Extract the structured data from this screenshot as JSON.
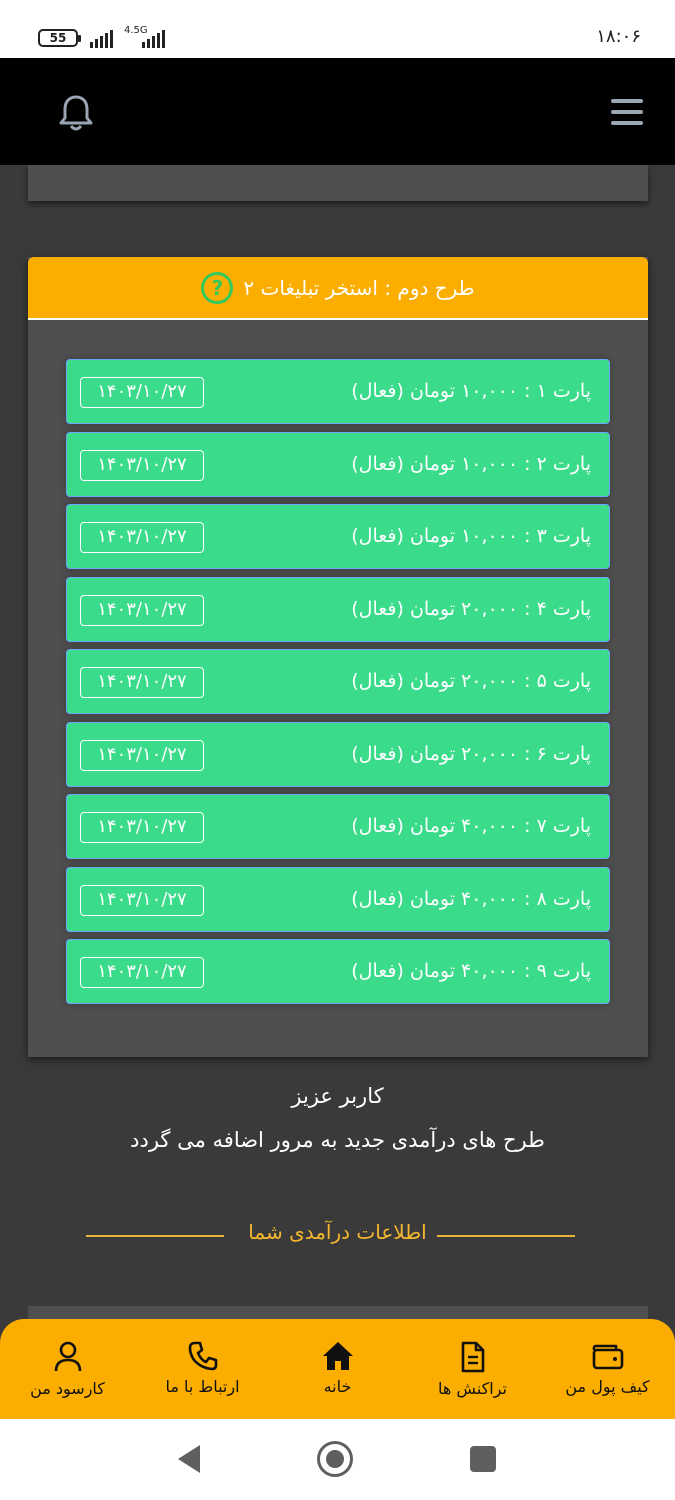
{
  "status_bar": {
    "battery": "55",
    "network": "4.5G",
    "clock": "۱۸:۰۶"
  },
  "plan": {
    "title": "طرح دوم : استخر تبلیغات ۲",
    "help_icon": "question-circle-icon",
    "parts": [
      {
        "label": "پارت ۱ : ۱۰,۰۰۰ تومان (فعال)",
        "date": "۱۴۰۳/۱۰/۲۷"
      },
      {
        "label": "پارت ۲ : ۱۰,۰۰۰ تومان (فعال)",
        "date": "۱۴۰۳/۱۰/۲۷"
      },
      {
        "label": "پارت ۳ : ۱۰,۰۰۰ تومان (فعال)",
        "date": "۱۴۰۳/۱۰/۲۷"
      },
      {
        "label": "پارت ۴ : ۲۰,۰۰۰ تومان (فعال)",
        "date": "۱۴۰۳/۱۰/۲۷"
      },
      {
        "label": "پارت ۵ : ۲۰,۰۰۰ تومان (فعال)",
        "date": "۱۴۰۳/۱۰/۲۷"
      },
      {
        "label": "پارت ۶ : ۲۰,۰۰۰ تومان (فعال)",
        "date": "۱۴۰۳/۱۰/۲۷"
      },
      {
        "label": "پارت ۷ : ۴۰,۰۰۰ تومان (فعال)",
        "date": "۱۴۰۳/۱۰/۲۷"
      },
      {
        "label": "پارت ۸ : ۴۰,۰۰۰ تومان (فعال)",
        "date": "۱۴۰۳/۱۰/۲۷"
      },
      {
        "label": "پارت ۹ : ۴۰,۰۰۰ تومان (فعال)",
        "date": "۱۴۰۳/۱۰/۲۷"
      }
    ]
  },
  "notice": {
    "line1": "کاربر عزیز",
    "line2": "طرح های درآمدی جدید به مرور اضافه می گردد"
  },
  "income_section": {
    "title": "اطلاعات درآمدی شما"
  },
  "colors": {
    "accent": "#fbad00",
    "part_bg": "#3bdb8c",
    "card_bg": "#4f4f4f",
    "page_bg": "#3a3a3a"
  },
  "bottom_nav": {
    "items": [
      {
        "label": "کیف پول من",
        "icon": "wallet-icon"
      },
      {
        "label": "تراکنش ها",
        "icon": "document-icon"
      },
      {
        "label": "خانه",
        "icon": "home-icon"
      },
      {
        "label": "ارتباط با ما",
        "icon": "phone-icon"
      },
      {
        "label": "کارسود من",
        "icon": "user-icon"
      }
    ]
  }
}
